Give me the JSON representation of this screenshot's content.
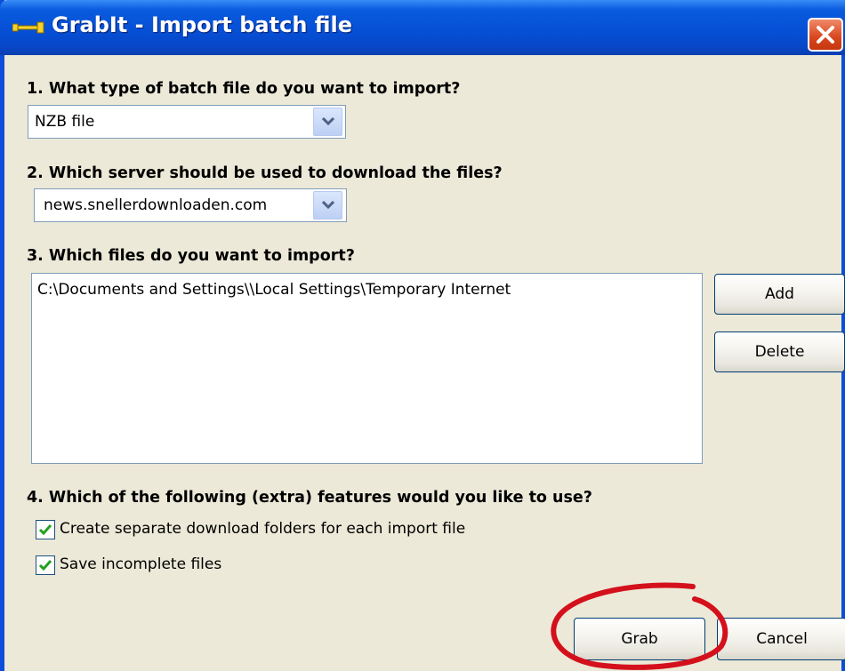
{
  "window": {
    "title": "GrabIt - Import batch file",
    "icon": "grabit-tool-icon",
    "title_bar_color": "#0a5bde",
    "close_icon": "close-icon"
  },
  "section1": {
    "label": "1. What type of batch file do you want to import?",
    "select_value": "NZB file"
  },
  "section2": {
    "label": "2. Which server should be used to download the files?",
    "select_value": "news.snellerdownloaden.com"
  },
  "section3": {
    "label": "3. Which files do you want to import?",
    "files": [
      "C:\\Documents and Settings\\\\Local Settings\\Temporary Internet"
    ],
    "add_label": "Add",
    "delete_label": "Delete"
  },
  "section4": {
    "label": "4. Which of the following (extra) features would you like to use?",
    "options": [
      {
        "label": "Create separate download folders for each import file",
        "checked": true
      },
      {
        "label": "Save incomplete files",
        "checked": true
      }
    ]
  },
  "footer": {
    "grab_label": "Grab",
    "cancel_label": "Cancel",
    "highlight_color": "#d4101c"
  }
}
